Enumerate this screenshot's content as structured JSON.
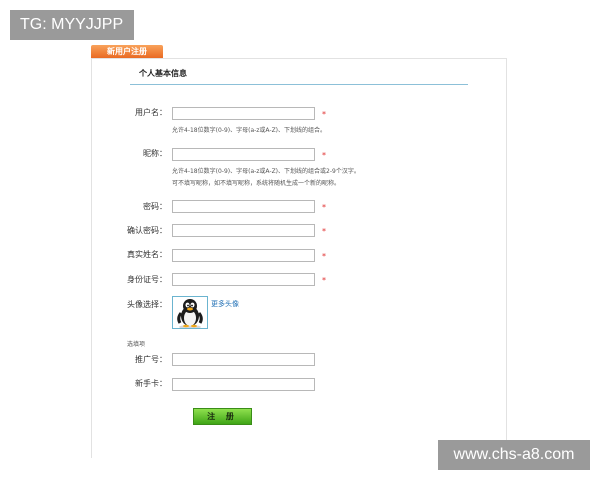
{
  "watermarks": {
    "top_left": "TG: MYYJJPP",
    "bottom_right": "www.chs-a8.com"
  },
  "tab": {
    "label": "新用户注册"
  },
  "section": {
    "title": "个人基本信息",
    "optional_title": "选填项"
  },
  "fields": {
    "username": {
      "label": "用户名：",
      "value": "",
      "required_mark": "*",
      "hint": "允许4-18位数字(0-9)、字母(a-z或A-Z)、下划线的组合。"
    },
    "nickname": {
      "label": "昵称：",
      "value": "",
      "required_mark": "*",
      "hint_line1": "允许4-18位数字(0-9)、字母(a-z或A-Z)、下划线的组合或2-9个汉字。",
      "hint_line2": "可不填写昵称，如不填写昵称，系统将随机生成一个新的昵称。"
    },
    "password": {
      "label": "密码：",
      "value": "",
      "required_mark": "*"
    },
    "confirm_password": {
      "label": "确认密码：",
      "value": "",
      "required_mark": "*"
    },
    "real_name": {
      "label": "真实姓名：",
      "value": "",
      "required_mark": "*"
    },
    "id_number": {
      "label": "身份证号：",
      "value": "",
      "required_mark": "*"
    },
    "avatar": {
      "label": "头像选择：",
      "more_link": "更多头像",
      "icon": "penguin-avatar-icon"
    },
    "referral": {
      "label": "推广号：",
      "value": ""
    },
    "newbie_card": {
      "label": "新手卡：",
      "value": ""
    }
  },
  "submit": {
    "label": "注 册"
  },
  "colors": {
    "tab_orange": "#e8661f",
    "required_red": "#e03030",
    "link_blue": "#1f6fb5",
    "submit_green": "#3fa516",
    "rule_blue": "#8cc0d8"
  }
}
